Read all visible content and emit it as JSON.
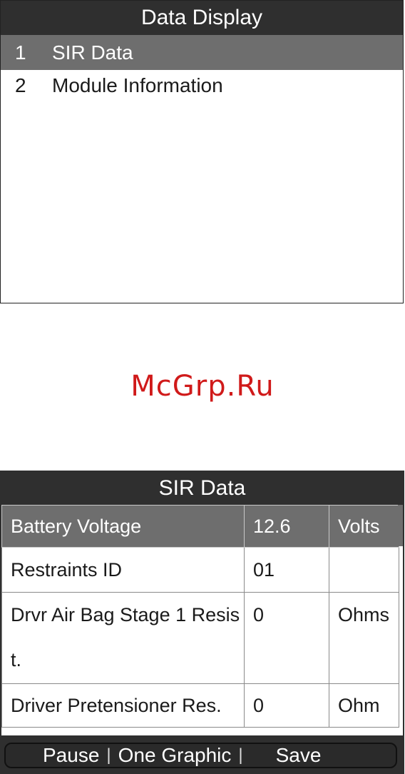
{
  "menu_screen": {
    "title": "Data Display",
    "items": [
      {
        "number": "1",
        "label": "SIR Data",
        "selected": true
      },
      {
        "number": "2",
        "label": "Module Information",
        "selected": false
      }
    ]
  },
  "watermark": "McGrp.Ru",
  "data_screen": {
    "title": "SIR Data",
    "rows": [
      {
        "name": "Battery Voltage",
        "value": "12.6",
        "unit": "Volts",
        "selected": true
      },
      {
        "name": "Restraints ID",
        "value": "01",
        "unit": ""
      },
      {
        "name": "Drvr Air Bag Stage 1 Resist.",
        "value": "0",
        "unit": "Ohms"
      },
      {
        "name": "Driver Pretensioner Res.",
        "value": "0",
        "unit": "Ohm"
      }
    ],
    "footer": {
      "pause": "Pause",
      "one_graphic": "One Graphic",
      "save": "Save",
      "separator": "|"
    }
  },
  "colors": {
    "title_bar": "#2f2f2f",
    "selection": "#6e6e6e",
    "watermark": "#d01a1a"
  }
}
